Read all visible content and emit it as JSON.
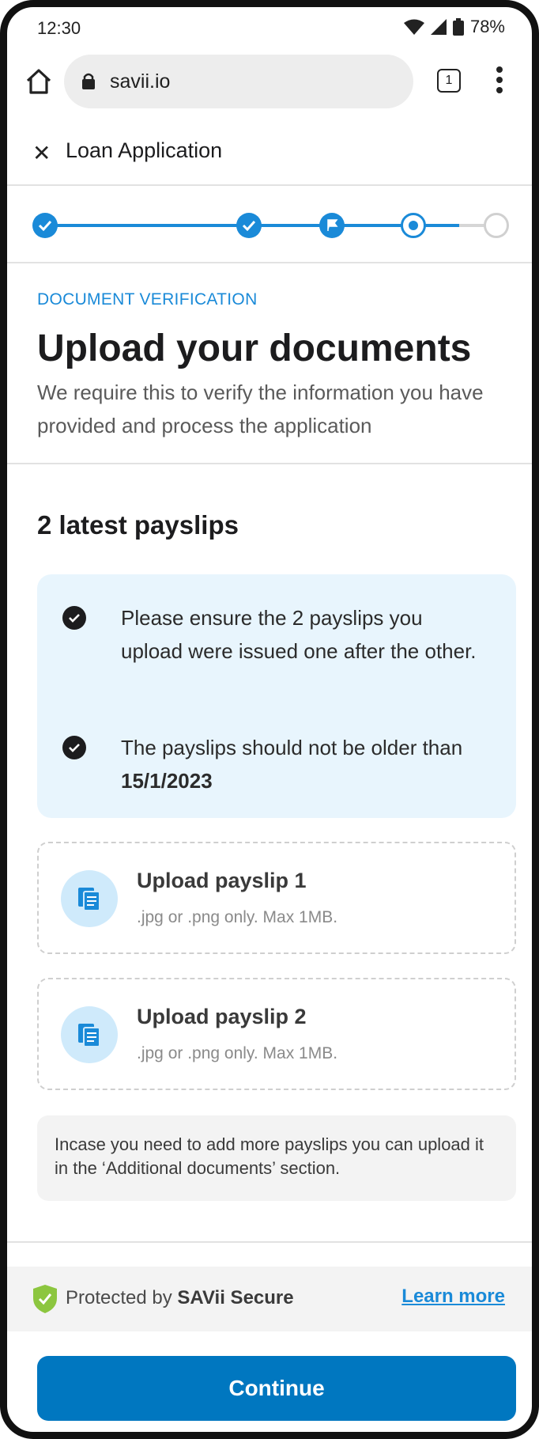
{
  "status_bar": {
    "time": "12:30",
    "battery": "78%"
  },
  "browser": {
    "url": "savii.io",
    "tab_count": "1"
  },
  "header": {
    "title": "Loan Application"
  },
  "stepper": {
    "total_steps": 5,
    "current_step": 4
  },
  "intro": {
    "eyebrow": "DOCUMENT VERIFICATION",
    "heading": "Upload your documents",
    "subtitle": "We require this to verify the information you have provided and process the application"
  },
  "payslips": {
    "title": "2 latest payslips",
    "info": [
      {
        "text": "Please ensure the 2 payslips you upload were issued one after the other."
      },
      {
        "text_before": "The payslips should not be older than ",
        "date": "15/1/2023"
      }
    ],
    "uploads": [
      {
        "label": "Upload payslip 1",
        "hint": ".jpg or .png only. Max 1MB."
      },
      {
        "label": "Upload payslip 2",
        "hint": ".jpg or .png only. Max 1MB."
      }
    ],
    "note": "Incase you need to add more payslips you can upload it in the ‘Additional documents’ section."
  },
  "secure": {
    "prefix": "Protected by ",
    "brand": "SAVii Secure",
    "learn_more": "Learn more"
  },
  "continue_label": "Continue",
  "colors": {
    "accent": "#1a8ad8",
    "button": "#0077c0",
    "info_bg": "#e8f5fd",
    "shield": "#8cc63f"
  }
}
